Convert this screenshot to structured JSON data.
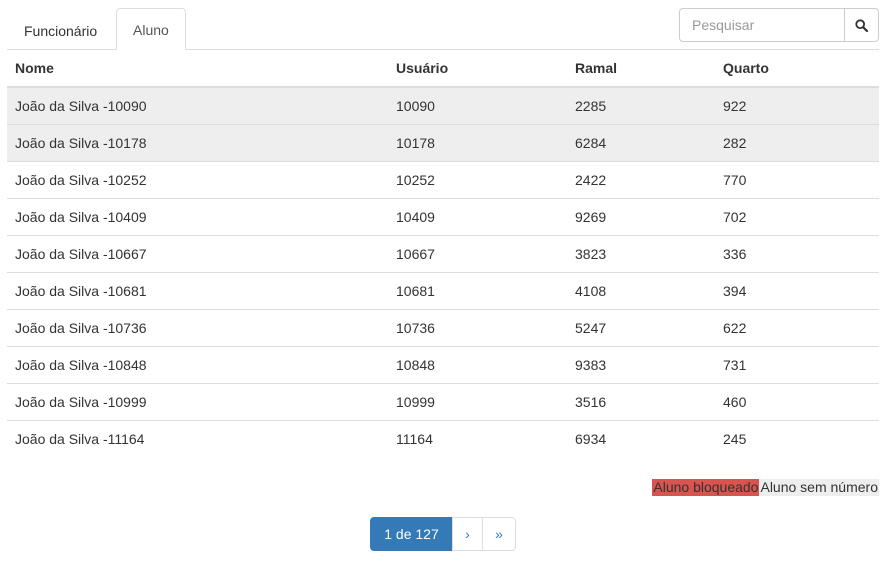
{
  "tabs": [
    {
      "label": "Funcionário"
    },
    {
      "label": "Aluno"
    }
  ],
  "search": {
    "placeholder": "Pesquisar",
    "value": "",
    "icon": "search-icon"
  },
  "table": {
    "headers": {
      "nome": "Nome",
      "usuario": "Usuário",
      "ramal": "Ramal",
      "quarto": "Quarto"
    },
    "rows": [
      {
        "nome": "João da Silva -10090",
        "usuario": "10090",
        "ramal": "2285",
        "quarto": "922"
      },
      {
        "nome": "João da Silva -10178",
        "usuario": "10178",
        "ramal": "6284",
        "quarto": "282"
      },
      {
        "nome": "João da Silva -10252",
        "usuario": "10252",
        "ramal": "2422",
        "quarto": "770"
      },
      {
        "nome": "João da Silva -10409",
        "usuario": "10409",
        "ramal": "9269",
        "quarto": "702"
      },
      {
        "nome": "João da Silva -10667",
        "usuario": "10667",
        "ramal": "3823",
        "quarto": "336"
      },
      {
        "nome": "João da Silva -10681",
        "usuario": "10681",
        "ramal": "4108",
        "quarto": "394"
      },
      {
        "nome": "João da Silva -10736",
        "usuario": "10736",
        "ramal": "5247",
        "quarto": "622"
      },
      {
        "nome": "João da Silva -10848",
        "usuario": "10848",
        "ramal": "9383",
        "quarto": "731"
      },
      {
        "nome": "João da Silva -10999",
        "usuario": "10999",
        "ramal": "3516",
        "quarto": "460"
      },
      {
        "nome": "João da Silva -11164",
        "usuario": "11164",
        "ramal": "6934",
        "quarto": "245"
      }
    ]
  },
  "legend": {
    "blocked": {
      "label": "Aluno bloqueado",
      "color": "#d9534f"
    },
    "no_number": {
      "label": "Aluno sem número",
      "color": "#eeeeee"
    }
  },
  "pagination": {
    "current": "1 de 127",
    "next": "›",
    "last": "»"
  },
  "colors": {
    "primary": "#337ab7",
    "border": "#dddddd",
    "highlight_row": "#eeeeee"
  }
}
